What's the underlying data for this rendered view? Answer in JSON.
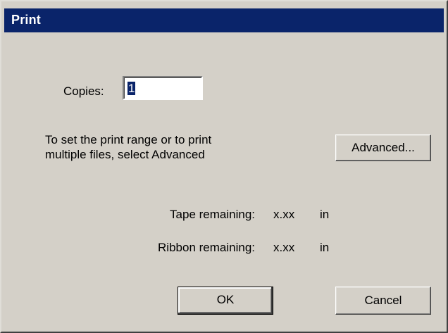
{
  "window": {
    "title": "Print"
  },
  "copies": {
    "label": "Copies:",
    "value": "1"
  },
  "range_note": {
    "line1": "To set the print range or to print",
    "line2": "multiple files, select Advanced"
  },
  "buttons": {
    "advanced": "Advanced...",
    "ok": "OK",
    "cancel": "Cancel"
  },
  "status": {
    "tape_label": "Tape remaining:",
    "tape_value": "x.xx",
    "tape_unit": "in",
    "ribbon_label": "Ribbon remaining:",
    "ribbon_value": "x.xx",
    "ribbon_unit": "in"
  },
  "colors": {
    "titlebar": "#0a246a",
    "dialog_face": "#d4d0c8",
    "selection": "#0a246a"
  }
}
